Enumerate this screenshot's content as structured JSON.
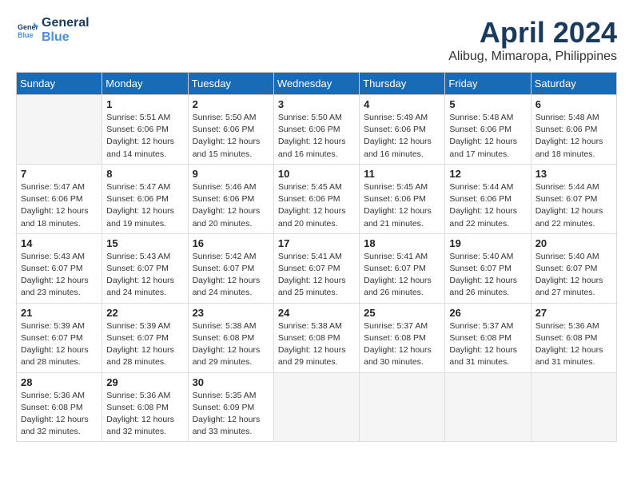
{
  "logo": {
    "line1": "General",
    "line2": "Blue"
  },
  "title": "April 2024",
  "location": "Alibug, Mimaropa, Philippines",
  "days_header": [
    "Sunday",
    "Monday",
    "Tuesday",
    "Wednesday",
    "Thursday",
    "Friday",
    "Saturday"
  ],
  "weeks": [
    [
      {
        "day": "",
        "info": ""
      },
      {
        "day": "1",
        "info": "Sunrise: 5:51 AM\nSunset: 6:06 PM\nDaylight: 12 hours\nand 14 minutes."
      },
      {
        "day": "2",
        "info": "Sunrise: 5:50 AM\nSunset: 6:06 PM\nDaylight: 12 hours\nand 15 minutes."
      },
      {
        "day": "3",
        "info": "Sunrise: 5:50 AM\nSunset: 6:06 PM\nDaylight: 12 hours\nand 16 minutes."
      },
      {
        "day": "4",
        "info": "Sunrise: 5:49 AM\nSunset: 6:06 PM\nDaylight: 12 hours\nand 16 minutes."
      },
      {
        "day": "5",
        "info": "Sunrise: 5:48 AM\nSunset: 6:06 PM\nDaylight: 12 hours\nand 17 minutes."
      },
      {
        "day": "6",
        "info": "Sunrise: 5:48 AM\nSunset: 6:06 PM\nDaylight: 12 hours\nand 18 minutes."
      }
    ],
    [
      {
        "day": "7",
        "info": "Sunrise: 5:47 AM\nSunset: 6:06 PM\nDaylight: 12 hours\nand 18 minutes."
      },
      {
        "day": "8",
        "info": "Sunrise: 5:47 AM\nSunset: 6:06 PM\nDaylight: 12 hours\nand 19 minutes."
      },
      {
        "day": "9",
        "info": "Sunrise: 5:46 AM\nSunset: 6:06 PM\nDaylight: 12 hours\nand 20 minutes."
      },
      {
        "day": "10",
        "info": "Sunrise: 5:45 AM\nSunset: 6:06 PM\nDaylight: 12 hours\nand 20 minutes."
      },
      {
        "day": "11",
        "info": "Sunrise: 5:45 AM\nSunset: 6:06 PM\nDaylight: 12 hours\nand 21 minutes."
      },
      {
        "day": "12",
        "info": "Sunrise: 5:44 AM\nSunset: 6:06 PM\nDaylight: 12 hours\nand 22 minutes."
      },
      {
        "day": "13",
        "info": "Sunrise: 5:44 AM\nSunset: 6:07 PM\nDaylight: 12 hours\nand 22 minutes."
      }
    ],
    [
      {
        "day": "14",
        "info": "Sunrise: 5:43 AM\nSunset: 6:07 PM\nDaylight: 12 hours\nand 23 minutes."
      },
      {
        "day": "15",
        "info": "Sunrise: 5:43 AM\nSunset: 6:07 PM\nDaylight: 12 hours\nand 24 minutes."
      },
      {
        "day": "16",
        "info": "Sunrise: 5:42 AM\nSunset: 6:07 PM\nDaylight: 12 hours\nand 24 minutes."
      },
      {
        "day": "17",
        "info": "Sunrise: 5:41 AM\nSunset: 6:07 PM\nDaylight: 12 hours\nand 25 minutes."
      },
      {
        "day": "18",
        "info": "Sunrise: 5:41 AM\nSunset: 6:07 PM\nDaylight: 12 hours\nand 26 minutes."
      },
      {
        "day": "19",
        "info": "Sunrise: 5:40 AM\nSunset: 6:07 PM\nDaylight: 12 hours\nand 26 minutes."
      },
      {
        "day": "20",
        "info": "Sunrise: 5:40 AM\nSunset: 6:07 PM\nDaylight: 12 hours\nand 27 minutes."
      }
    ],
    [
      {
        "day": "21",
        "info": "Sunrise: 5:39 AM\nSunset: 6:07 PM\nDaylight: 12 hours\nand 28 minutes."
      },
      {
        "day": "22",
        "info": "Sunrise: 5:39 AM\nSunset: 6:07 PM\nDaylight: 12 hours\nand 28 minutes."
      },
      {
        "day": "23",
        "info": "Sunrise: 5:38 AM\nSunset: 6:08 PM\nDaylight: 12 hours\nand 29 minutes."
      },
      {
        "day": "24",
        "info": "Sunrise: 5:38 AM\nSunset: 6:08 PM\nDaylight: 12 hours\nand 29 minutes."
      },
      {
        "day": "25",
        "info": "Sunrise: 5:37 AM\nSunset: 6:08 PM\nDaylight: 12 hours\nand 30 minutes."
      },
      {
        "day": "26",
        "info": "Sunrise: 5:37 AM\nSunset: 6:08 PM\nDaylight: 12 hours\nand 31 minutes."
      },
      {
        "day": "27",
        "info": "Sunrise: 5:36 AM\nSunset: 6:08 PM\nDaylight: 12 hours\nand 31 minutes."
      }
    ],
    [
      {
        "day": "28",
        "info": "Sunrise: 5:36 AM\nSunset: 6:08 PM\nDaylight: 12 hours\nand 32 minutes."
      },
      {
        "day": "29",
        "info": "Sunrise: 5:36 AM\nSunset: 6:08 PM\nDaylight: 12 hours\nand 32 minutes."
      },
      {
        "day": "30",
        "info": "Sunrise: 5:35 AM\nSunset: 6:09 PM\nDaylight: 12 hours\nand 33 minutes."
      },
      {
        "day": "",
        "info": ""
      },
      {
        "day": "",
        "info": ""
      },
      {
        "day": "",
        "info": ""
      },
      {
        "day": "",
        "info": ""
      }
    ]
  ]
}
